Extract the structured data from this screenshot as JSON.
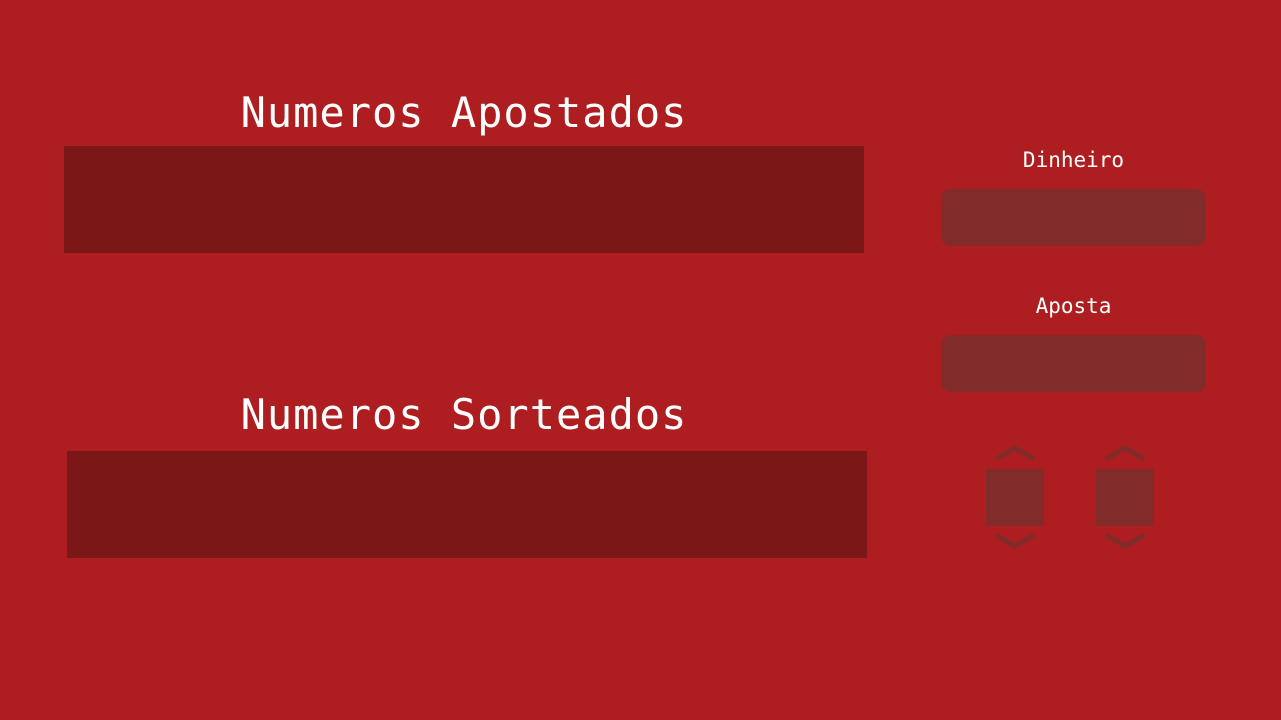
{
  "apostados": {
    "title": "Numeros Apostados",
    "numbers": []
  },
  "sorteados": {
    "title": "Numeros Sorteados",
    "numbers": []
  },
  "dinheiro": {
    "label": "Dinheiro",
    "value": ""
  },
  "aposta": {
    "label": "Aposta",
    "value": ""
  },
  "steppers": [
    {
      "up_icon": "chevron-up-icon",
      "down_icon": "chevron-down-icon"
    },
    {
      "up_icon": "chevron-up-icon",
      "down_icon": "chevron-down-icon"
    }
  ],
  "colors": {
    "background": "#ae1e20",
    "panel": "#7c1718",
    "field": "#822b2b",
    "text": "#ffffff"
  }
}
